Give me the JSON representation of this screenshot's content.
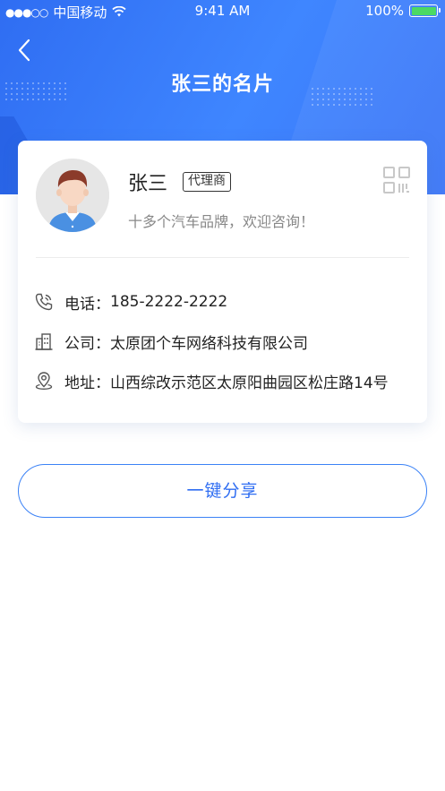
{
  "status_bar": {
    "signal": "●●●○○",
    "carrier": "中国移动",
    "wifi_icon": "wifi-icon",
    "time": "9:41 AM",
    "battery": "100%",
    "battery_color": "#4cd964"
  },
  "nav": {
    "back_icon": "chevron-left-icon",
    "title": "张三的名片"
  },
  "card": {
    "name": "张三",
    "role_badge": "代理商",
    "slogan": "十多个汽车品牌，欢迎咨询！",
    "qr_icon": "qr-code-icon",
    "avatar": "avatar",
    "phone": {
      "icon": "phone-icon",
      "label": "电话：",
      "value": "185-2222-2222"
    },
    "company": {
      "icon": "building-icon",
      "label": "公司：",
      "value": "太原团个车网络科技有限公司"
    },
    "address": {
      "icon": "location-pin-icon",
      "label": "地址：",
      "value": "山西综改示范区太原阳曲园区松庄路14号"
    }
  },
  "share_button": {
    "label": "一键分享"
  },
  "colors": {
    "header_gradient_start": "#2f6df2",
    "header_gradient_end": "#3f86ff",
    "accent": "#2f6df2",
    "text_primary": "#222222",
    "text_secondary": "#888888"
  }
}
